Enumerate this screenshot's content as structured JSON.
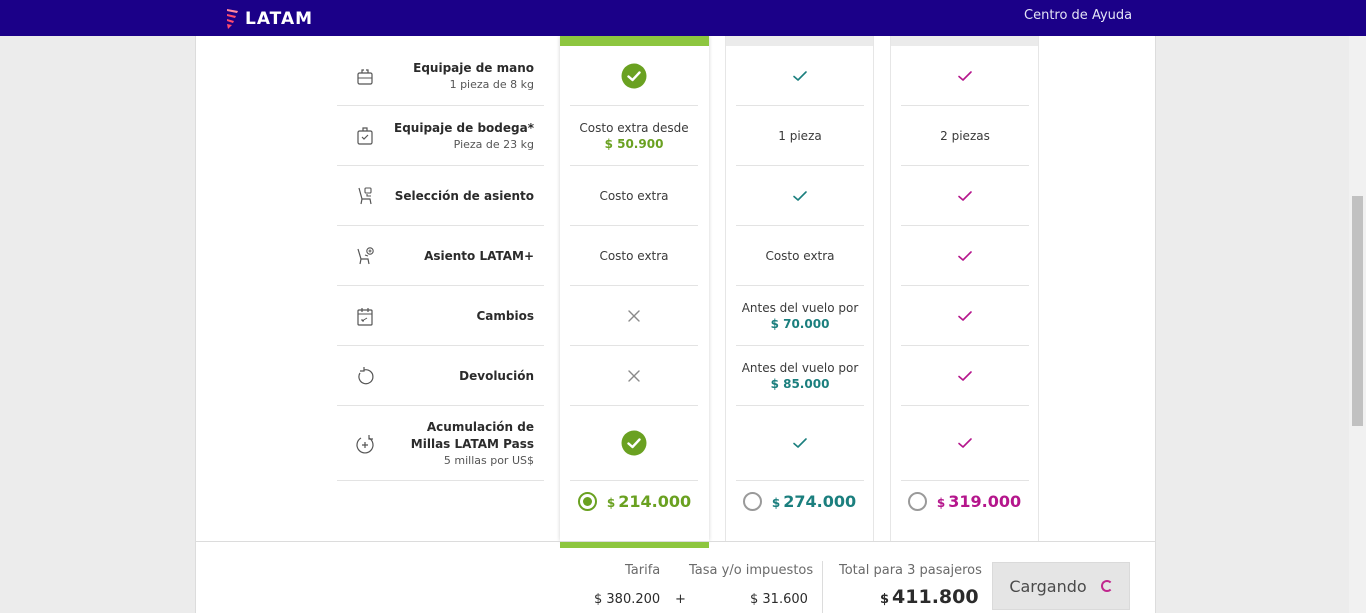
{
  "header": {
    "logo_text": "LATAM",
    "help_link": "Centro de Ayuda",
    "brand_color": "#1b0088"
  },
  "features": [
    {
      "name": "Equipaje de mano",
      "sub": "1 pieza de 8 kg",
      "icon": "carry-on-bag-icon"
    },
    {
      "name": "Equipaje de bodega*",
      "sub": "Pieza de 23 kg",
      "icon": "checked-bag-icon"
    },
    {
      "name": "Selección de asiento",
      "sub": "",
      "icon": "seat-icon"
    },
    {
      "name": "Asiento LATAM+",
      "sub": "",
      "icon": "seat-plus-icon"
    },
    {
      "name": "Cambios",
      "sub": "",
      "icon": "calendar-change-icon"
    },
    {
      "name": "Devolución",
      "sub": "",
      "icon": "refund-icon"
    },
    {
      "name": "Acumulación de Millas LATAM Pass",
      "sub": "5 millas por US$",
      "icon": "miles-icon"
    }
  ],
  "fares": [
    {
      "id": "light",
      "color": "#6aa121",
      "selected": true,
      "currency": "$",
      "price": "214.000",
      "cells": [
        {
          "type": "check-filled"
        },
        {
          "type": "text",
          "text": "Costo extra desde",
          "amount": "$ 50.900"
        },
        {
          "type": "text",
          "text": "Costo extra"
        },
        {
          "type": "text",
          "text": "Costo extra"
        },
        {
          "type": "cross"
        },
        {
          "type": "cross"
        },
        {
          "type": "check-filled"
        }
      ]
    },
    {
      "id": "plus",
      "color": "#1b7f7e",
      "selected": false,
      "currency": "$",
      "price": "274.000",
      "cells": [
        {
          "type": "check"
        },
        {
          "type": "text",
          "text": "1 pieza"
        },
        {
          "type": "check"
        },
        {
          "type": "text",
          "text": "Costo extra"
        },
        {
          "type": "text",
          "text": "Antes del vuelo por",
          "amount": "$ 70.000"
        },
        {
          "type": "text",
          "text": "Antes del vuelo por",
          "amount": "$ 85.000"
        },
        {
          "type": "check"
        }
      ]
    },
    {
      "id": "top",
      "color": "#b5168c",
      "selected": false,
      "currency": "$",
      "price": "319.000",
      "cells": [
        {
          "type": "check"
        },
        {
          "type": "text",
          "text": "2 piezas"
        },
        {
          "type": "check"
        },
        {
          "type": "check"
        },
        {
          "type": "check"
        },
        {
          "type": "check"
        },
        {
          "type": "check"
        }
      ]
    }
  ],
  "summary": {
    "tarifa_label": "Tarifa",
    "tarifa_value": "$ 380.200",
    "plus": "+",
    "taxes_label": "Tasa y/o impuestos",
    "taxes_value": "$ 31.600",
    "total_label": "Total para 3 pasajeros",
    "total_currency": "$",
    "total_value": "411.800",
    "button_label": "Cargando"
  }
}
